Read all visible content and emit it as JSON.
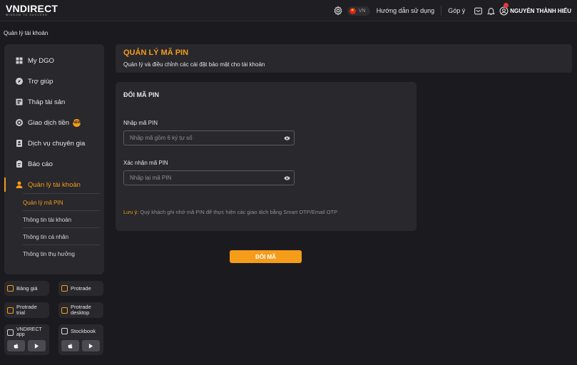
{
  "brand": {
    "logo_text": "VNDIRECT",
    "tagline": "WISDOM TO SUCCESS"
  },
  "header": {
    "language_code": "VN",
    "guide_link": "Hướng dẫn sử dụng",
    "feedback_link": "Góp ý",
    "user_name": "NGUYỄN THÀNH HIẾU",
    "icons": [
      "gear-icon",
      "vn-flag-icon",
      "mail-icon",
      "bell-icon",
      "user-icon"
    ]
  },
  "breadcrumb": "Quản lý tài khoản",
  "sidebar": {
    "items": [
      {
        "label": "My DGO",
        "icon": "grid-icon"
      },
      {
        "label": "Trợ giúp",
        "icon": "help-icon"
      },
      {
        "label": "Tháp tài sản",
        "icon": "asset-icon"
      },
      {
        "label": "Giao dịch tiền",
        "icon": "money-icon",
        "badge": "NEW"
      },
      {
        "label": "Dịch vụ chuyên gia",
        "icon": "expert-icon"
      },
      {
        "label": "Báo cáo",
        "icon": "report-icon"
      },
      {
        "label": "Quản lý tài khoản",
        "icon": "account-icon",
        "active": true
      }
    ],
    "sub_items": [
      {
        "label": "Quản lý mã PIN",
        "active": true
      },
      {
        "label": "Thông tin tài khoản"
      },
      {
        "label": "Thông tin cá nhân"
      },
      {
        "label": "Thông tin thụ hưởng"
      }
    ]
  },
  "quick_links": [
    {
      "label": "Bảng giá",
      "icon": "external-link-icon"
    },
    {
      "label": "Protrade",
      "icon": "external-link-icon"
    },
    {
      "label": "Protrade trial",
      "icon": "external-link-icon"
    },
    {
      "label": "Protrade desktop",
      "icon": "external-link-icon"
    },
    {
      "label": "VNDIRECT app",
      "icon": "vndirect-app-icon"
    },
    {
      "label": "Stockbook",
      "icon": "stockbook-icon"
    }
  ],
  "main": {
    "title": "QUẢN LÝ MÃ PIN",
    "description": "Quản lý và điều chỉnh các cài đặt bảo mật cho tài khoản",
    "form": {
      "title": "ĐỔI MÃ PIN",
      "pin_label": "Nhập mã PIN",
      "pin_placeholder": "Nhập mã gồm 6 ký tự số",
      "pin_value": "",
      "confirm_label": "Xác nhận mã PIN",
      "confirm_placeholder": "Nhập lại mã PIN",
      "confirm_value": "",
      "note_key": "Lưu ý:",
      "note_text": "Quý khách ghi nhớ mã PIN để thực hiện các giao dịch bằng Smart OTP/Email OTP"
    },
    "submit_label": "ĐỔI MÃ"
  },
  "colors": {
    "accent": "#f59c1a",
    "background": "#1b1b1f",
    "panel": "#28282d"
  }
}
